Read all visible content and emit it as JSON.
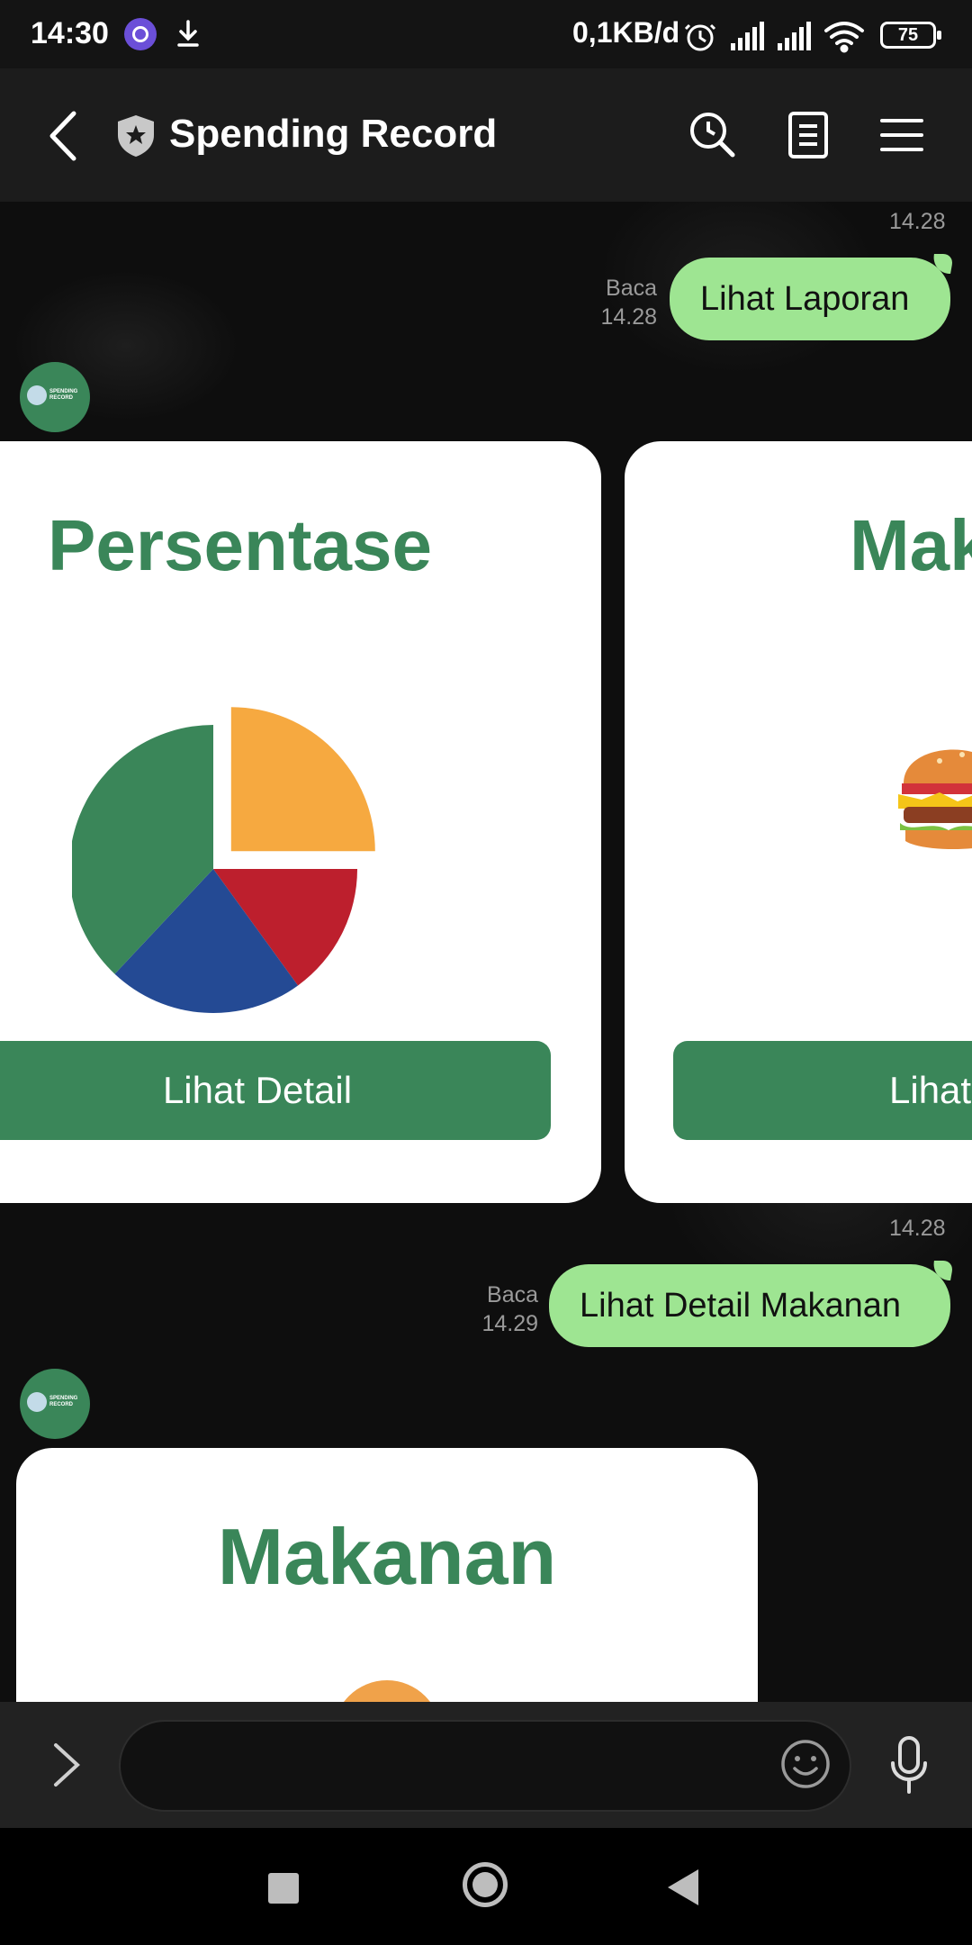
{
  "status_bar": {
    "time": "14:30",
    "network_speed": "0,1KB/d",
    "battery": "75",
    "icons": [
      "opera-icon",
      "download-icon",
      "alarm-icon",
      "signal-icon",
      "signal-icon",
      "wifi-icon",
      "battery-icon"
    ]
  },
  "header": {
    "title": "Spending Record",
    "icons": [
      "back-icon",
      "shield-star-icon",
      "history-search-icon",
      "notes-icon",
      "menu-icon"
    ]
  },
  "messages": {
    "first": {
      "top_time": "14.28",
      "read_label": "Baca",
      "read_time": "14.28",
      "text": "Lihat Laporan"
    },
    "second": {
      "top_time": "14.28",
      "read_label": "Baca",
      "read_time": "14.29",
      "text": "Lihat Detail Makanan"
    }
  },
  "avatar": {
    "text": "SPENDING RECORD"
  },
  "carousel": {
    "cards": [
      {
        "title": "Persentase",
        "button": "Lihat Detail"
      },
      {
        "title": "Mak",
        "button": "Lihat"
      }
    ]
  },
  "detail_card": {
    "title": "Makanan"
  },
  "chart_data": {
    "type": "pie",
    "slices": [
      {
        "value": 25,
        "color": "#f6a940",
        "exploded": true
      },
      {
        "value": 15,
        "color": "#bd1f2d"
      },
      {
        "value": 22,
        "color": "#244a94"
      },
      {
        "value": 38,
        "color": "#3a8659"
      }
    ]
  },
  "composer": {
    "placeholder": ""
  },
  "colors": {
    "accent": "#3a8659",
    "bubble": "#9ee592"
  }
}
